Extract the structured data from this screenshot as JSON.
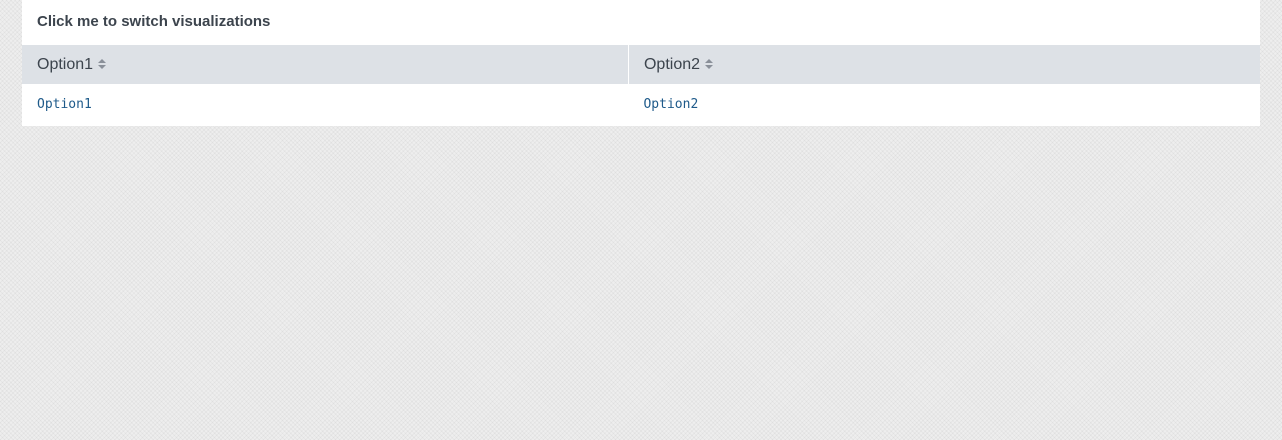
{
  "panel": {
    "title": "Click me to switch visualizations"
  },
  "table": {
    "columns": [
      {
        "label": "Option1",
        "sort_icon": "sort-icon"
      },
      {
        "label": "Option2",
        "sort_icon": "sort-icon"
      }
    ],
    "rows": [
      [
        "Option1",
        "Option2"
      ]
    ]
  },
  "colors": {
    "header_bg": "#dde1e6",
    "link": "#1e5a8a",
    "title": "#3c444d"
  }
}
